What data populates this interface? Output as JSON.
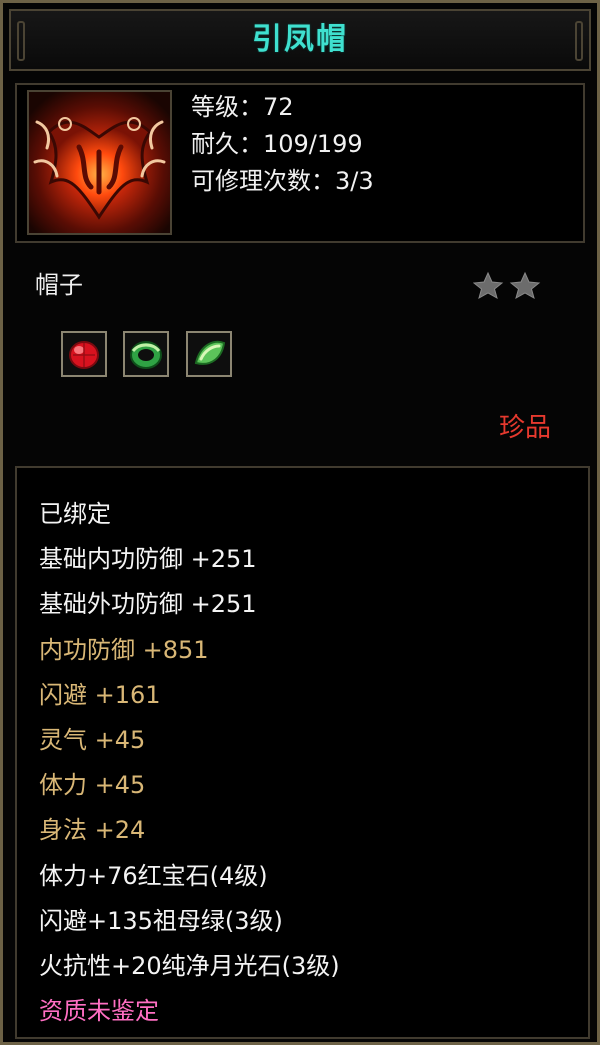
{
  "item": {
    "name": "引凤帽",
    "level_text": "等级：72",
    "durability_text": "耐久：109/199",
    "repair_text": "可修理次数：3/3",
    "category": "帽子",
    "star_count": 2,
    "rarity": "珍品",
    "icon": "phoenix-hat-icon"
  },
  "gems": [
    {
      "name": "ruby-gem-icon",
      "color": "#e8202b"
    },
    {
      "name": "emerald-gem-icon",
      "color": "#39b34a"
    },
    {
      "name": "moonstone-gem-icon",
      "color": "#6fd06a"
    }
  ],
  "attributes": [
    {
      "text": "已绑定",
      "style": "white"
    },
    {
      "text": "基础内功防御  +251",
      "style": "white"
    },
    {
      "text": "基础外功防御  +251",
      "style": "white"
    },
    {
      "text": "内功防御  +851",
      "style": "gold"
    },
    {
      "text": "闪避  +161",
      "style": "gold"
    },
    {
      "text": "灵气  +45",
      "style": "gold"
    },
    {
      "text": "体力  +45",
      "style": "gold"
    },
    {
      "text": "身法  +24",
      "style": "gold"
    },
    {
      "text": "体力+76红宝石(4级)",
      "style": "white"
    },
    {
      "text": "闪避+135祖母绿(3级)",
      "style": "white"
    },
    {
      "text": "火抗性+20纯净月光石(3级)",
      "style": "white"
    },
    {
      "text": "资质未鉴定",
      "style": "pink"
    }
  ],
  "colors": {
    "title": "#3fe0cf",
    "rarity": "#e6392e",
    "gold_attr": "#d9b776",
    "unidentified": "#ff6fc3",
    "border": "#6d6246"
  }
}
